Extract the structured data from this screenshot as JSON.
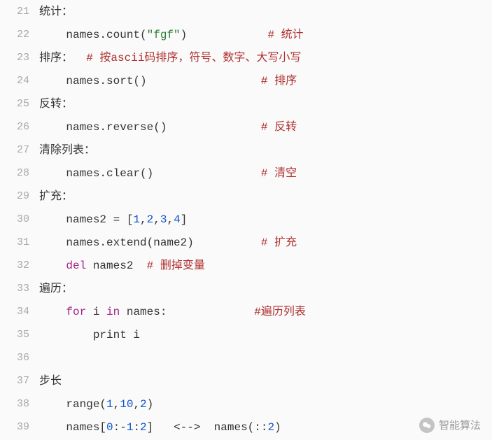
{
  "lines": [
    {
      "no": 21,
      "tokens": [
        {
          "cls": "ident",
          "t": "统计："
        }
      ]
    },
    {
      "no": 22,
      "tokens": [
        {
          "cls": "ident",
          "t": "    names.count("
        },
        {
          "cls": "str",
          "t": "\"fgf\""
        },
        {
          "cls": "ident",
          "t": ")            "
        },
        {
          "cls": "cmt",
          "t": "# 统计"
        }
      ]
    },
    {
      "no": 23,
      "tokens": [
        {
          "cls": "ident",
          "t": "排序：  "
        },
        {
          "cls": "cmt",
          "t": "# 按ascii码排序，符号、数字、大写小写"
        }
      ]
    },
    {
      "no": 24,
      "tokens": [
        {
          "cls": "ident",
          "t": "    names.sort()                 "
        },
        {
          "cls": "cmt",
          "t": "# 排序"
        }
      ]
    },
    {
      "no": 25,
      "tokens": [
        {
          "cls": "ident",
          "t": "反转："
        }
      ]
    },
    {
      "no": 26,
      "tokens": [
        {
          "cls": "ident",
          "t": "    names.reverse()              "
        },
        {
          "cls": "cmt",
          "t": "# 反转"
        }
      ]
    },
    {
      "no": 27,
      "tokens": [
        {
          "cls": "ident",
          "t": "清除列表："
        }
      ]
    },
    {
      "no": 28,
      "tokens": [
        {
          "cls": "ident",
          "t": "    names.clear()                "
        },
        {
          "cls": "cmt",
          "t": "# 清空"
        }
      ]
    },
    {
      "no": 29,
      "tokens": [
        {
          "cls": "ident",
          "t": "扩充："
        }
      ]
    },
    {
      "no": 30,
      "tokens": [
        {
          "cls": "ident",
          "t": "    names2 = ["
        },
        {
          "cls": "num",
          "t": "1"
        },
        {
          "cls": "ident",
          "t": ","
        },
        {
          "cls": "num",
          "t": "2"
        },
        {
          "cls": "ident",
          "t": ","
        },
        {
          "cls": "num",
          "t": "3"
        },
        {
          "cls": "ident",
          "t": ","
        },
        {
          "cls": "num",
          "t": "4"
        },
        {
          "cls": "ident",
          "t": "]"
        }
      ]
    },
    {
      "no": 31,
      "tokens": [
        {
          "cls": "ident",
          "t": "    names.extend(name2)          "
        },
        {
          "cls": "cmt",
          "t": "# 扩充"
        }
      ]
    },
    {
      "no": 32,
      "tokens": [
        {
          "cls": "ident",
          "t": "    "
        },
        {
          "cls": "del",
          "t": "del"
        },
        {
          "cls": "ident",
          "t": " names2  "
        },
        {
          "cls": "cmt",
          "t": "# 删掉变量"
        }
      ]
    },
    {
      "no": 33,
      "tokens": [
        {
          "cls": "ident",
          "t": "遍历："
        }
      ]
    },
    {
      "no": 34,
      "tokens": [
        {
          "cls": "ident",
          "t": "    "
        },
        {
          "cls": "kw",
          "t": "for"
        },
        {
          "cls": "ident",
          "t": " i "
        },
        {
          "cls": "kw",
          "t": "in"
        },
        {
          "cls": "ident",
          "t": " names:             "
        },
        {
          "cls": "cmt",
          "t": "#遍历列表"
        }
      ]
    },
    {
      "no": 35,
      "tokens": [
        {
          "cls": "ident",
          "t": "        "
        },
        {
          "cls": "print",
          "t": "print"
        },
        {
          "cls": "ident",
          "t": " i"
        }
      ]
    },
    {
      "no": 36,
      "tokens": [
        {
          "cls": "ident",
          "t": ""
        }
      ]
    },
    {
      "no": 37,
      "tokens": [
        {
          "cls": "ident",
          "t": "步长"
        }
      ]
    },
    {
      "no": 38,
      "tokens": [
        {
          "cls": "ident",
          "t": "    range("
        },
        {
          "cls": "num",
          "t": "1"
        },
        {
          "cls": "ident",
          "t": ","
        },
        {
          "cls": "num",
          "t": "10"
        },
        {
          "cls": "ident",
          "t": ","
        },
        {
          "cls": "num",
          "t": "2"
        },
        {
          "cls": "ident",
          "t": ")"
        }
      ]
    },
    {
      "no": 39,
      "tokens": [
        {
          "cls": "ident",
          "t": "    names["
        },
        {
          "cls": "num",
          "t": "0"
        },
        {
          "cls": "ident",
          "t": ":-"
        },
        {
          "cls": "num",
          "t": "1"
        },
        {
          "cls": "ident",
          "t": ":"
        },
        {
          "cls": "num",
          "t": "2"
        },
        {
          "cls": "ident",
          "t": "]   <-->  names(::"
        },
        {
          "cls": "num",
          "t": "2"
        },
        {
          "cls": "ident",
          "t": ")"
        }
      ]
    }
  ],
  "watermark": {
    "label": "智能算法"
  }
}
